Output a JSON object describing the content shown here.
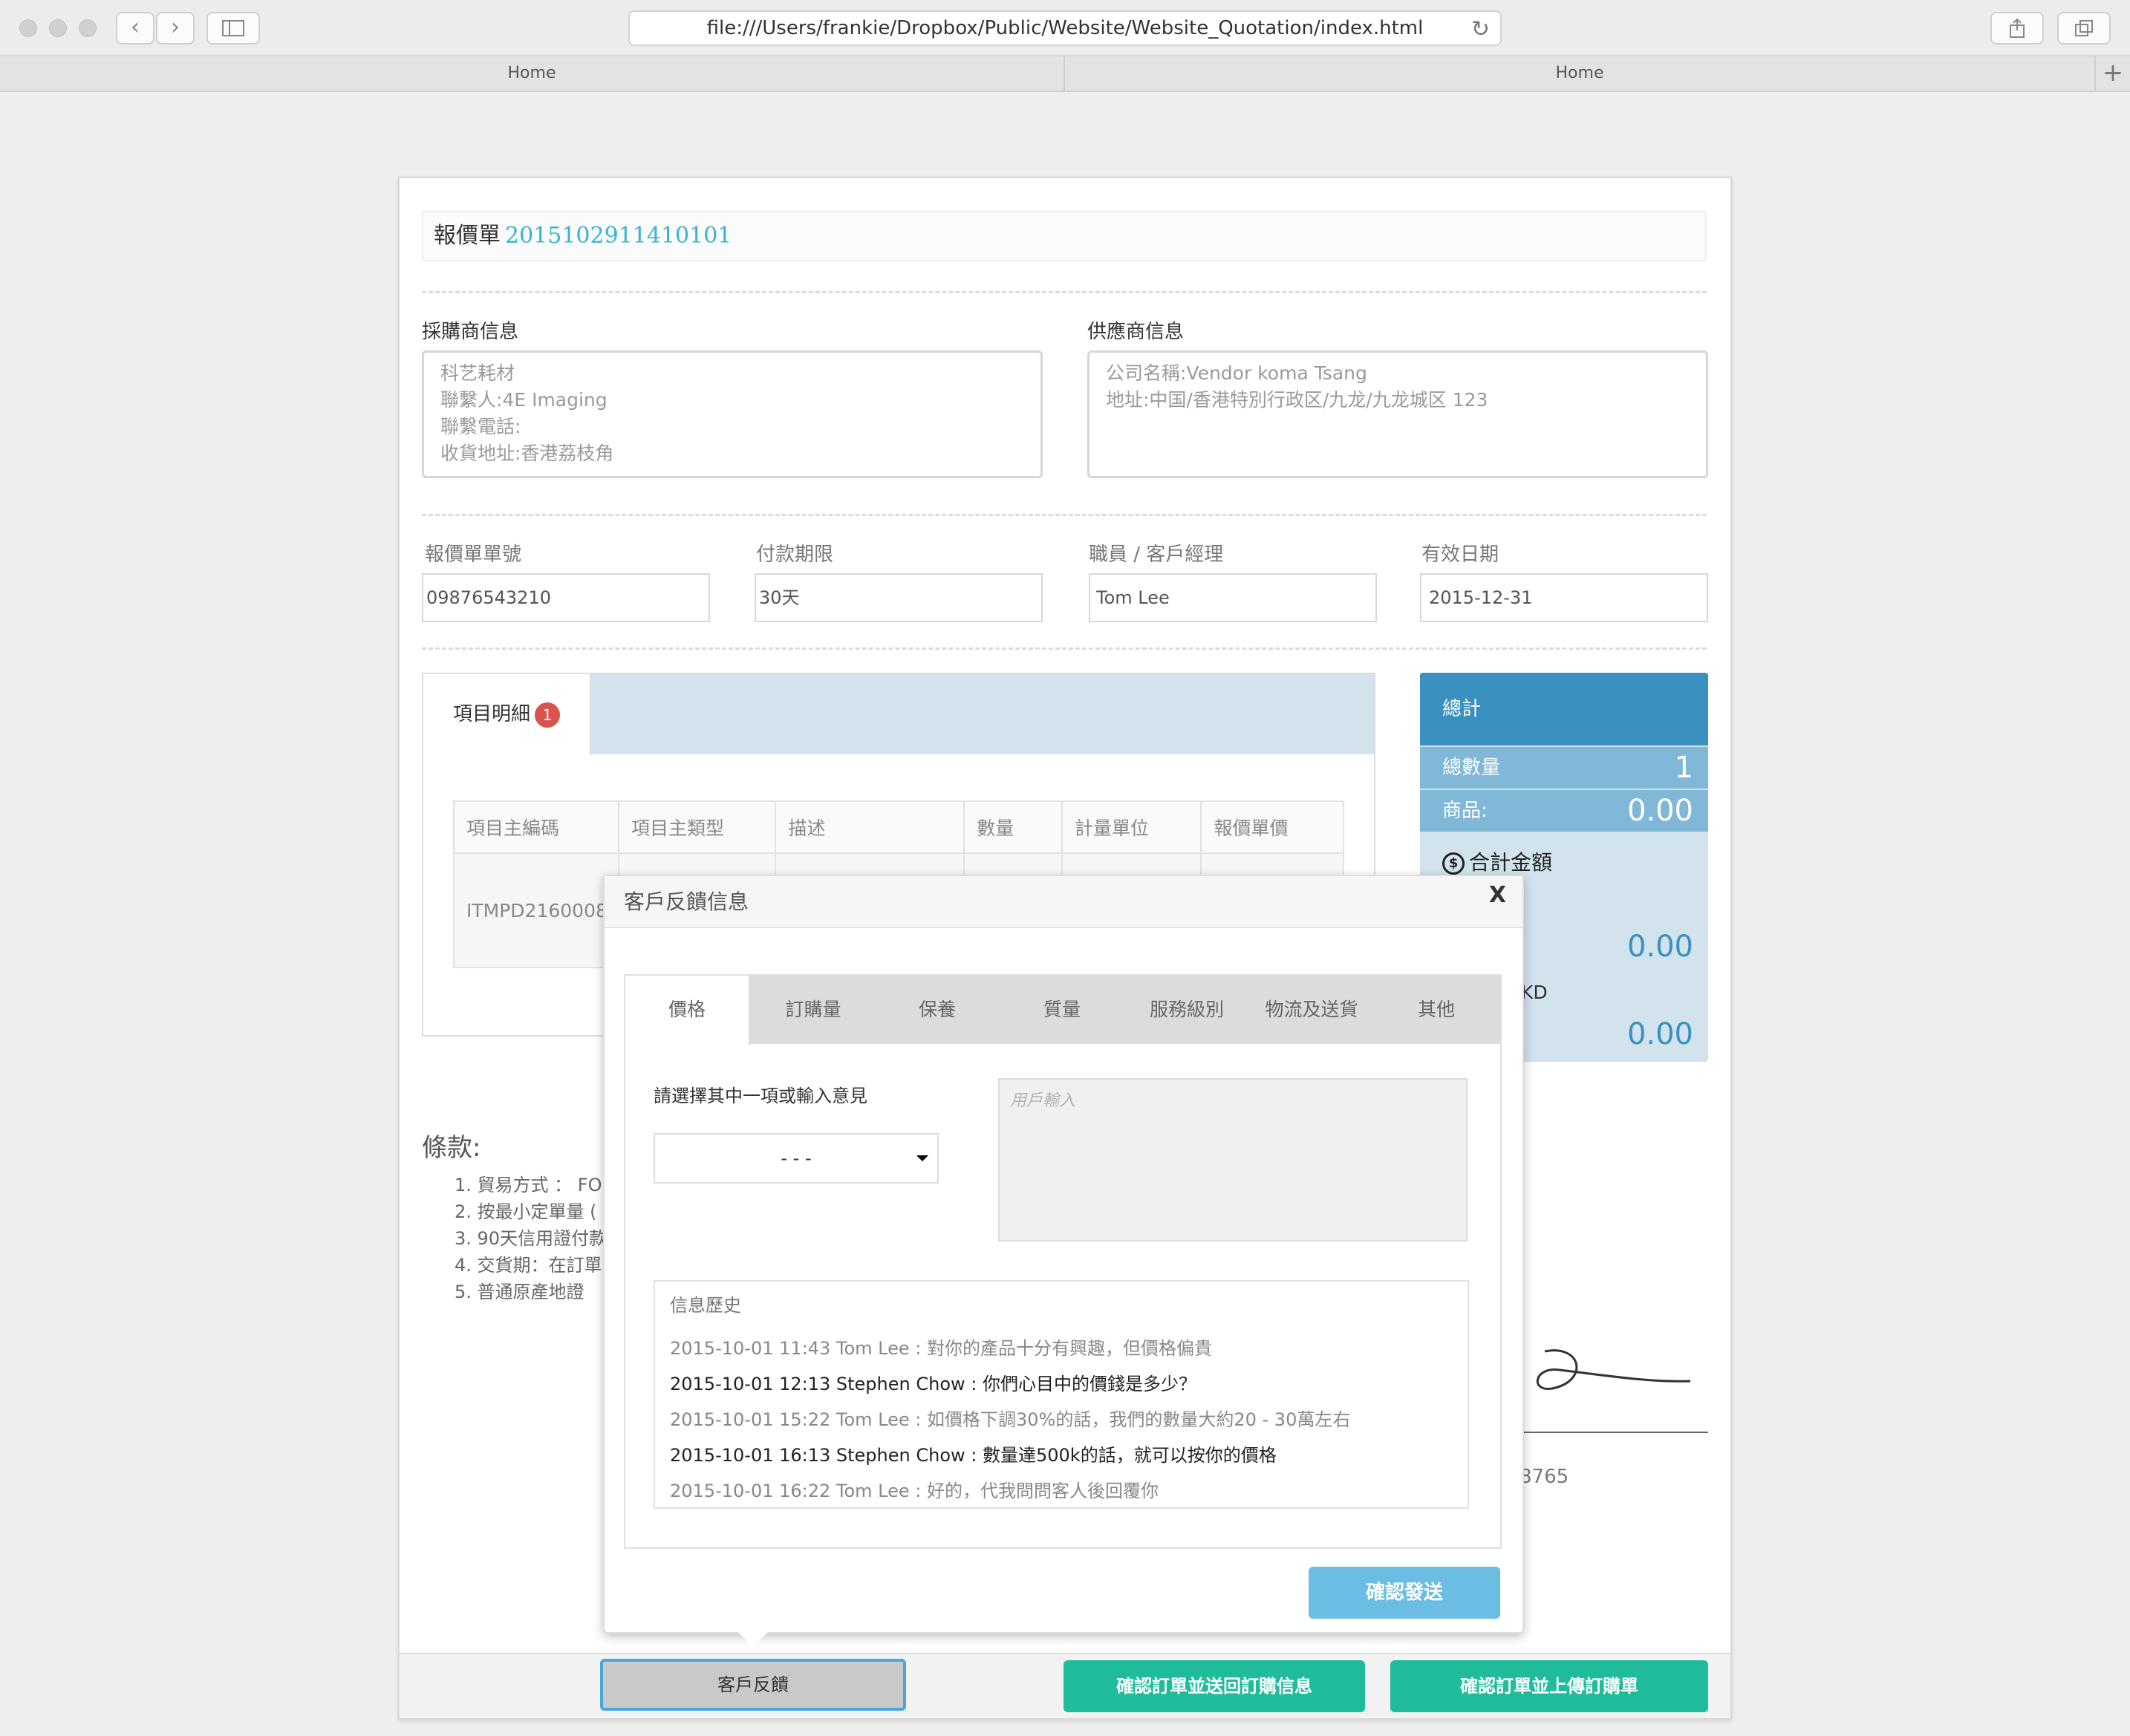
{
  "browser": {
    "url": "file:///Users/frankie/Dropbox/Public/Website/Website_Quotation/index.html",
    "tabs": [
      "Home",
      "Home"
    ]
  },
  "quote": {
    "title": "報價單",
    "number": "2015102911410101"
  },
  "buyer": {
    "label": "採購商信息",
    "lines": [
      "科艺耗材",
      "聯繫人:4E Imaging",
      "聯繫電話:",
      "收貨地址:香港荔枝角"
    ]
  },
  "supplier": {
    "label": "供應商信息",
    "lines": [
      "公司名稱:Vendor koma Tsang",
      "地址:中国/香港特別行政区/九龙/九龙城区 123"
    ]
  },
  "fields": [
    {
      "label": "報價單單號",
      "value": "09876543210"
    },
    {
      "label": "付款期限",
      "value": "30天"
    },
    {
      "label": "職員 / 客戶經理",
      "value": "Tom Lee"
    },
    {
      "label": "有效日期",
      "value": "2015-12-31"
    }
  ],
  "items": {
    "tab_label": "項目明細",
    "badge": "1",
    "headers": [
      "項目主編碼",
      "項目主類型",
      "描述",
      "數量",
      "計量單位",
      "報價單價"
    ],
    "rows": [
      [
        "ITMPD2160008",
        "",
        "",
        "",
        "",
        ""
      ]
    ]
  },
  "totals": {
    "title": "總計",
    "qty_label": "總數量",
    "qty_value": "1",
    "goods_label": "商品:",
    "goods_value": "0.00",
    "sum_label": "合計金額",
    "sum_value_1": "0.00",
    "currency_fragment": "KD",
    "sum_value_2": "0.00"
  },
  "terms": {
    "title": "條款:",
    "items": [
      "1.  貿易方式 ： FOB",
      "2.  按最小定單量 (",
      "3.  90天信用證付款",
      "4.  交貨期：在訂單",
      "5.  普通原產地證"
    ]
  },
  "signature": {
    "number_fragment": "8765"
  },
  "modal": {
    "title": "客戶反饋信息",
    "close": "X",
    "tabs": [
      "價格",
      "訂購量",
      "保養",
      "質量",
      "服務級別",
      "物流及送貨",
      "其他"
    ],
    "prompt": "請選擇其中一項或輸入意見",
    "select_value": "- - -",
    "input_placeholder": "用戶輸入",
    "history_title": "信息歷史",
    "history": [
      "2015-10-01 11:43 Tom Lee : 對你的產品十分有興趣，但價格偏貴",
      "2015-10-01 12:13 Stephen Chow : 你們心目中的價錢是多少？",
      "2015-10-01 15:22 Tom Lee : 如價格下調30%的話，我們的數量大約20 - 30萬左右",
      "2015-10-01 16:13 Stephen Chow : 數量達500k的話，就可以按你的價格",
      "2015-10-01 16:22 Tom Lee : 好的，代我問問客人後回覆你"
    ],
    "send_label": "確認發送"
  },
  "actions": {
    "feedback": "客戶反饋",
    "confirm_return": "確認訂單並送回訂購信息",
    "confirm_upload": "確認訂單並上傳訂購單"
  }
}
